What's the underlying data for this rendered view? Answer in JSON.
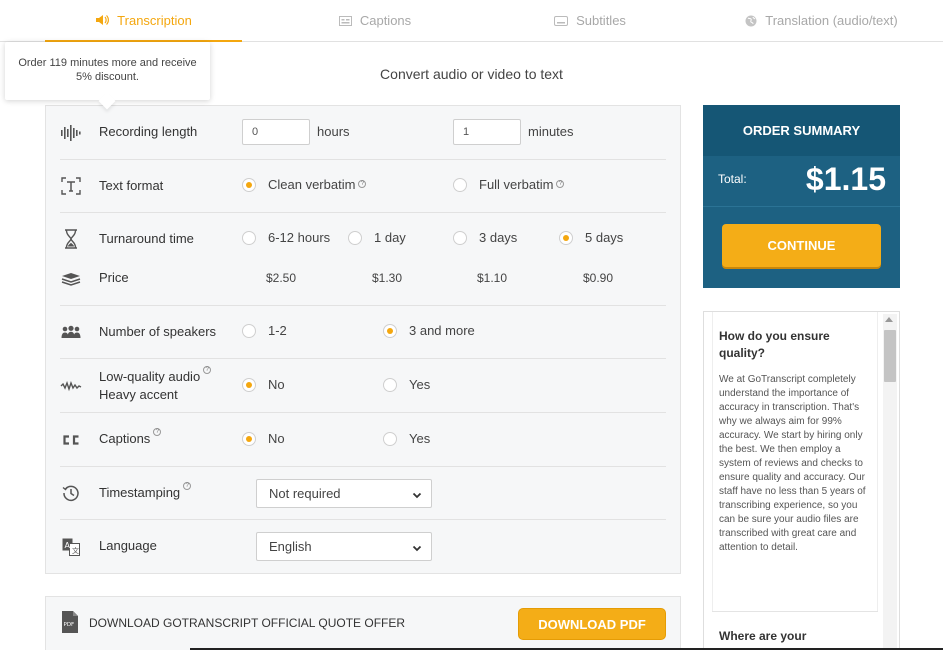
{
  "tabs": [
    {
      "label": "Transcription",
      "icon": "speaker-icon",
      "active": true
    },
    {
      "label": "Captions",
      "icon": "captions-icon",
      "active": false
    },
    {
      "label": "Subtitles",
      "icon": "subtitles-icon",
      "active": false
    },
    {
      "label": "Translation (audio/text)",
      "icon": "globe-icon",
      "active": false
    }
  ],
  "page_title": "Convert audio or video to text",
  "tooltip": "Order 119 minutes more and receive 5% discount.",
  "form": {
    "recording_length": {
      "label": "Recording length",
      "hours_value": "0",
      "hours_unit": "hours",
      "minutes_value": "1",
      "minutes_unit": "minutes"
    },
    "text_format": {
      "label": "Text format",
      "options": [
        "Clean verbatim",
        "Full verbatim"
      ],
      "selected": "Clean verbatim"
    },
    "turnaround": {
      "label": "Turnaround time",
      "options": [
        "6-12 hours",
        "1 day",
        "3 days",
        "5 days"
      ],
      "selected": "5 days"
    },
    "price": {
      "label": "Price",
      "values": [
        "$2.50",
        "$1.30",
        "$1.10",
        "$0.90"
      ]
    },
    "speakers": {
      "label": "Number of speakers",
      "options": [
        "1-2",
        "3 and more"
      ],
      "selected": "3 and more"
    },
    "low_quality": {
      "label_line1": "Low-quality audio",
      "label_line2": "Heavy accent",
      "options": [
        "No",
        "Yes"
      ],
      "selected": "No"
    },
    "captions": {
      "label": "Captions",
      "options": [
        "No",
        "Yes"
      ],
      "selected": "No"
    },
    "timestamping": {
      "label": "Timestamping",
      "value": "Not required"
    },
    "language": {
      "label": "Language",
      "value": "English"
    }
  },
  "quote": {
    "text": "DOWNLOAD GOTRANSCRIPT OFFICIAL QUOTE OFFER",
    "button": "DOWNLOAD PDF",
    "icon_text": "PDF"
  },
  "summary": {
    "title": "ORDER SUMMARY",
    "total_label": "Total:",
    "total": "$1.15",
    "button": "CONTINUE"
  },
  "faq": [
    {
      "question": "How do you ensure quality?",
      "answer": "We at GoTranscript completely understand the importance of accuracy in transcription. That's why we always aim for 99% accuracy. We start by hiring only the best. We then employ a system of reviews and checks to ensure quality and accuracy. Our staff have no less than 5 years of transcribing experience, so you can be sure your audio files are transcribed with great care and attention to detail."
    },
    {
      "question": "Where are your"
    }
  ],
  "colors": {
    "accent": "#f4a70f",
    "summary_bg": "#1d6182",
    "summary_header": "#155675"
  }
}
